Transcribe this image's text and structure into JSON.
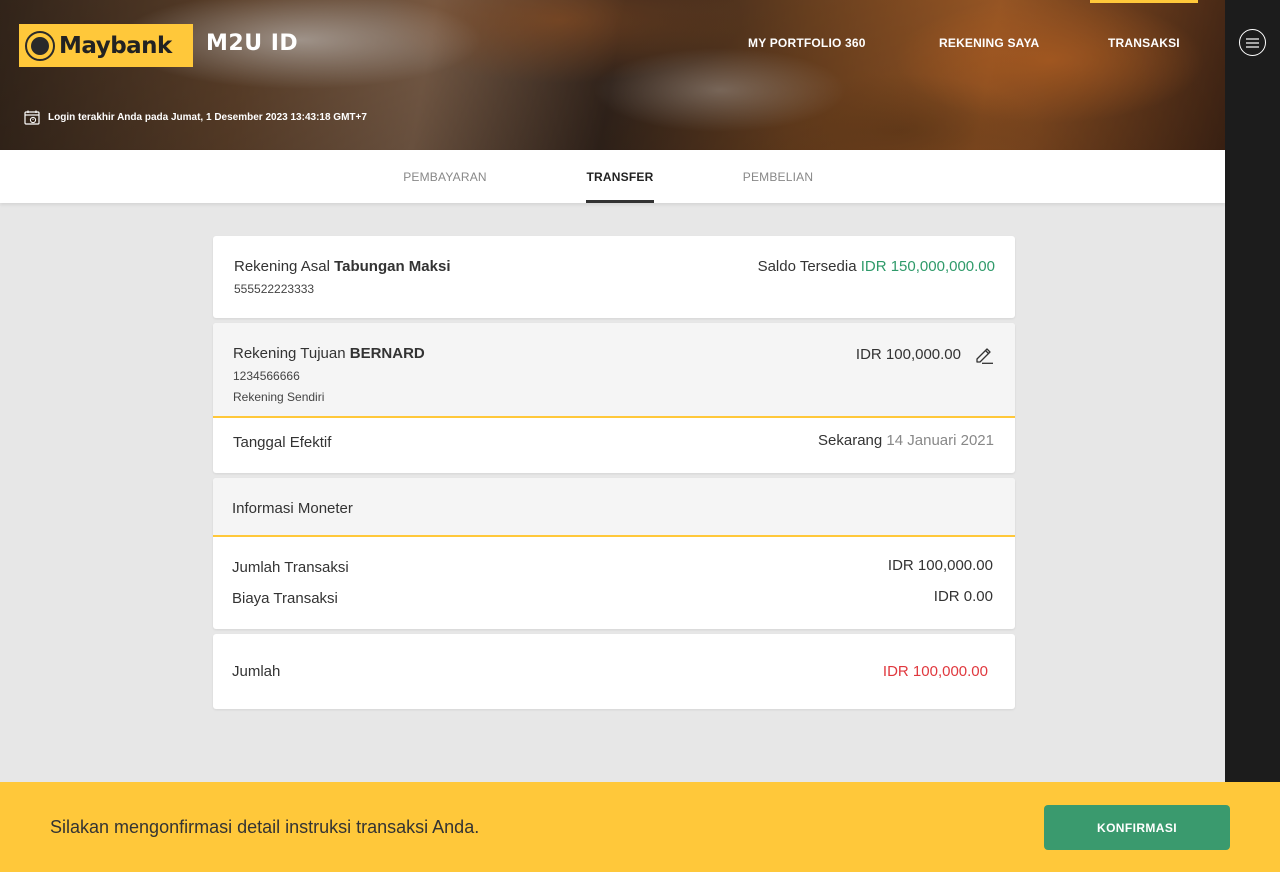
{
  "brand": {
    "logo_text": "Maybank",
    "product": "M2U ID"
  },
  "nav": {
    "items": [
      "MY PORTFOLIO 360",
      "REKENING SAYA",
      "TRANSAKSI"
    ]
  },
  "last_login": "Login terakhir Anda pada Jumat, 1 Desember 2023 13:43:18 GMT+7",
  "tabs": [
    "PEMBAYARAN",
    "TRANSFER",
    "PEMBELIAN"
  ],
  "source": {
    "label": "Rekening Asal",
    "name": "Tabungan Maksi",
    "number": "555522223333",
    "balance_label": "Saldo Tersedia",
    "balance": "IDR 150,000,000.00"
  },
  "destination": {
    "label": "Rekening Tujuan",
    "name": "BERNARD",
    "number": "1234566666",
    "type": "Rekening Sendiri",
    "amount": "IDR 100,000.00",
    "effective_label": "Tanggal Efektif",
    "effective_when": "Sekarang",
    "effective_date": "14 Januari 2021"
  },
  "monetary": {
    "title": "Informasi Moneter",
    "rows": [
      {
        "label": "Jumlah Transaksi",
        "value": "IDR 100,000.00"
      },
      {
        "label": "Biaya Transaksi",
        "value": "IDR 0.00"
      }
    ]
  },
  "total": {
    "label": "Jumlah",
    "value": "IDR 100,000.00"
  },
  "footer": {
    "message": "Silakan mengonfirmasi detail instruksi transaksi Anda.",
    "confirm_label": "KONFIRMASI"
  },
  "colors": {
    "brand_yellow": "#ffc83a",
    "green": "#3a9a6e",
    "red": "#e0383e"
  }
}
